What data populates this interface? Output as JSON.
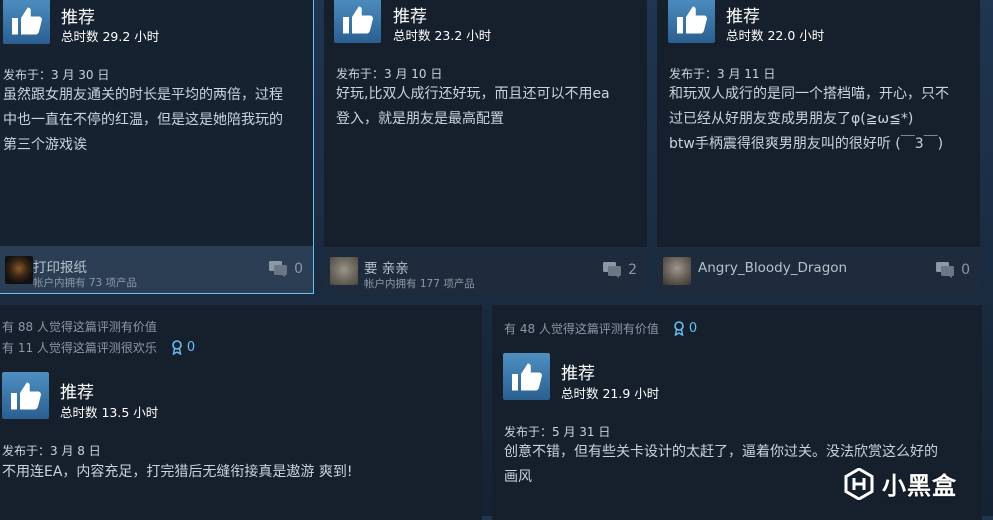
{
  "reviews": [
    {
      "recommend": "推荐",
      "hours": "总时数 29.2 小时",
      "date": "发布于：3 月 30 日",
      "lines": [
        "虽然跟女朋友通关的时长是平均的两倍，过程",
        "中也一直在不停的红温，但是这是她陪我玩的",
        "第三个游戏诶"
      ],
      "user": "打印报纸",
      "owns": "帐户内拥有 73 项产品",
      "comments": "0"
    },
    {
      "recommend": "推荐",
      "hours": "总时数 23.2 小时",
      "date": "发布于：3 月 10 日",
      "lines": [
        "好玩,比双人成行还好玩，而且还可以不用ea",
        "登入，就是朋友是最高配置"
      ],
      "user": "要 亲亲",
      "owns": "帐户内拥有 177 项产品",
      "comments": "2"
    },
    {
      "recommend": "推荐",
      "hours": "总时数 22.0 小时",
      "date": "发布于：3 月 11 日",
      "lines": [
        "和玩双人成行的是同一个搭档喵，开心，只不",
        "过已经从好朋友变成男朋友了φ(≧ω≦*)",
        "btw手柄震得很爽男朋友叫的很好听 (￣3￣)"
      ],
      "user": "Angry_Bloody_Dragon",
      "comments": "0"
    },
    {
      "helpful": "有 88 人觉得这篇评测有价值",
      "funny": "有 11 人觉得这篇评测很欢乐",
      "awards": "0",
      "recommend": "推荐",
      "hours": "总时数 13.5 小时",
      "date": "发布于：3 月 8 日",
      "lines": [
        "不用连EA，内容充足，打完猎后无缝衔接真是遨游 爽到!"
      ]
    },
    {
      "helpful": "有 48 人觉得这篇评测有价值",
      "awards": "0",
      "recommend": "推荐",
      "hours": "总时数 21.9 小时",
      "date": "发布于：5 月 31 日",
      "lines": [
        "创意不错，但有些关卡设计的太赶了，逼着你过关。没法欣赏这么好的",
        "画风"
      ]
    }
  ],
  "watermark": "小黑盒",
  "colors": {
    "accent": "#66c0f4",
    "card_bg": "#16202d",
    "page_bg": "#1b2838"
  }
}
